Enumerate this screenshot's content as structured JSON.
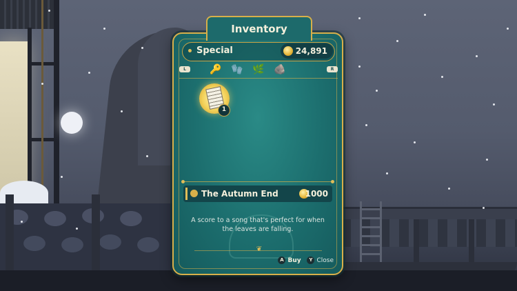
{
  "inventory": {
    "title": "Inventory",
    "category": "Special",
    "money": "24,891",
    "shoulder_left": "L",
    "shoulder_right": "R",
    "category_tabs": [
      {
        "icon": "key-icon",
        "glyph": "🔑",
        "active": true
      },
      {
        "icon": "gloves-icon",
        "glyph": "🧤",
        "active": false
      },
      {
        "icon": "plant-icon",
        "glyph": "🌿",
        "active": false
      },
      {
        "icon": "ore-icon",
        "glyph": "🪨",
        "active": false
      }
    ],
    "slot": {
      "item_icon": "sheet-music-icon",
      "quantity": "1"
    },
    "selected_item": {
      "name": "The Autumn End",
      "price": "1000",
      "description": "A score to a song that's perfect for when the leaves are falling."
    },
    "prompts": {
      "buy_button": "A",
      "buy_label": "Buy",
      "close_button": "Y",
      "close_label": "Close"
    }
  },
  "colors": {
    "panel_teal": "#1c6e6e",
    "gold_border": "#d8b04a",
    "text_cream": "#f4f0dc"
  }
}
